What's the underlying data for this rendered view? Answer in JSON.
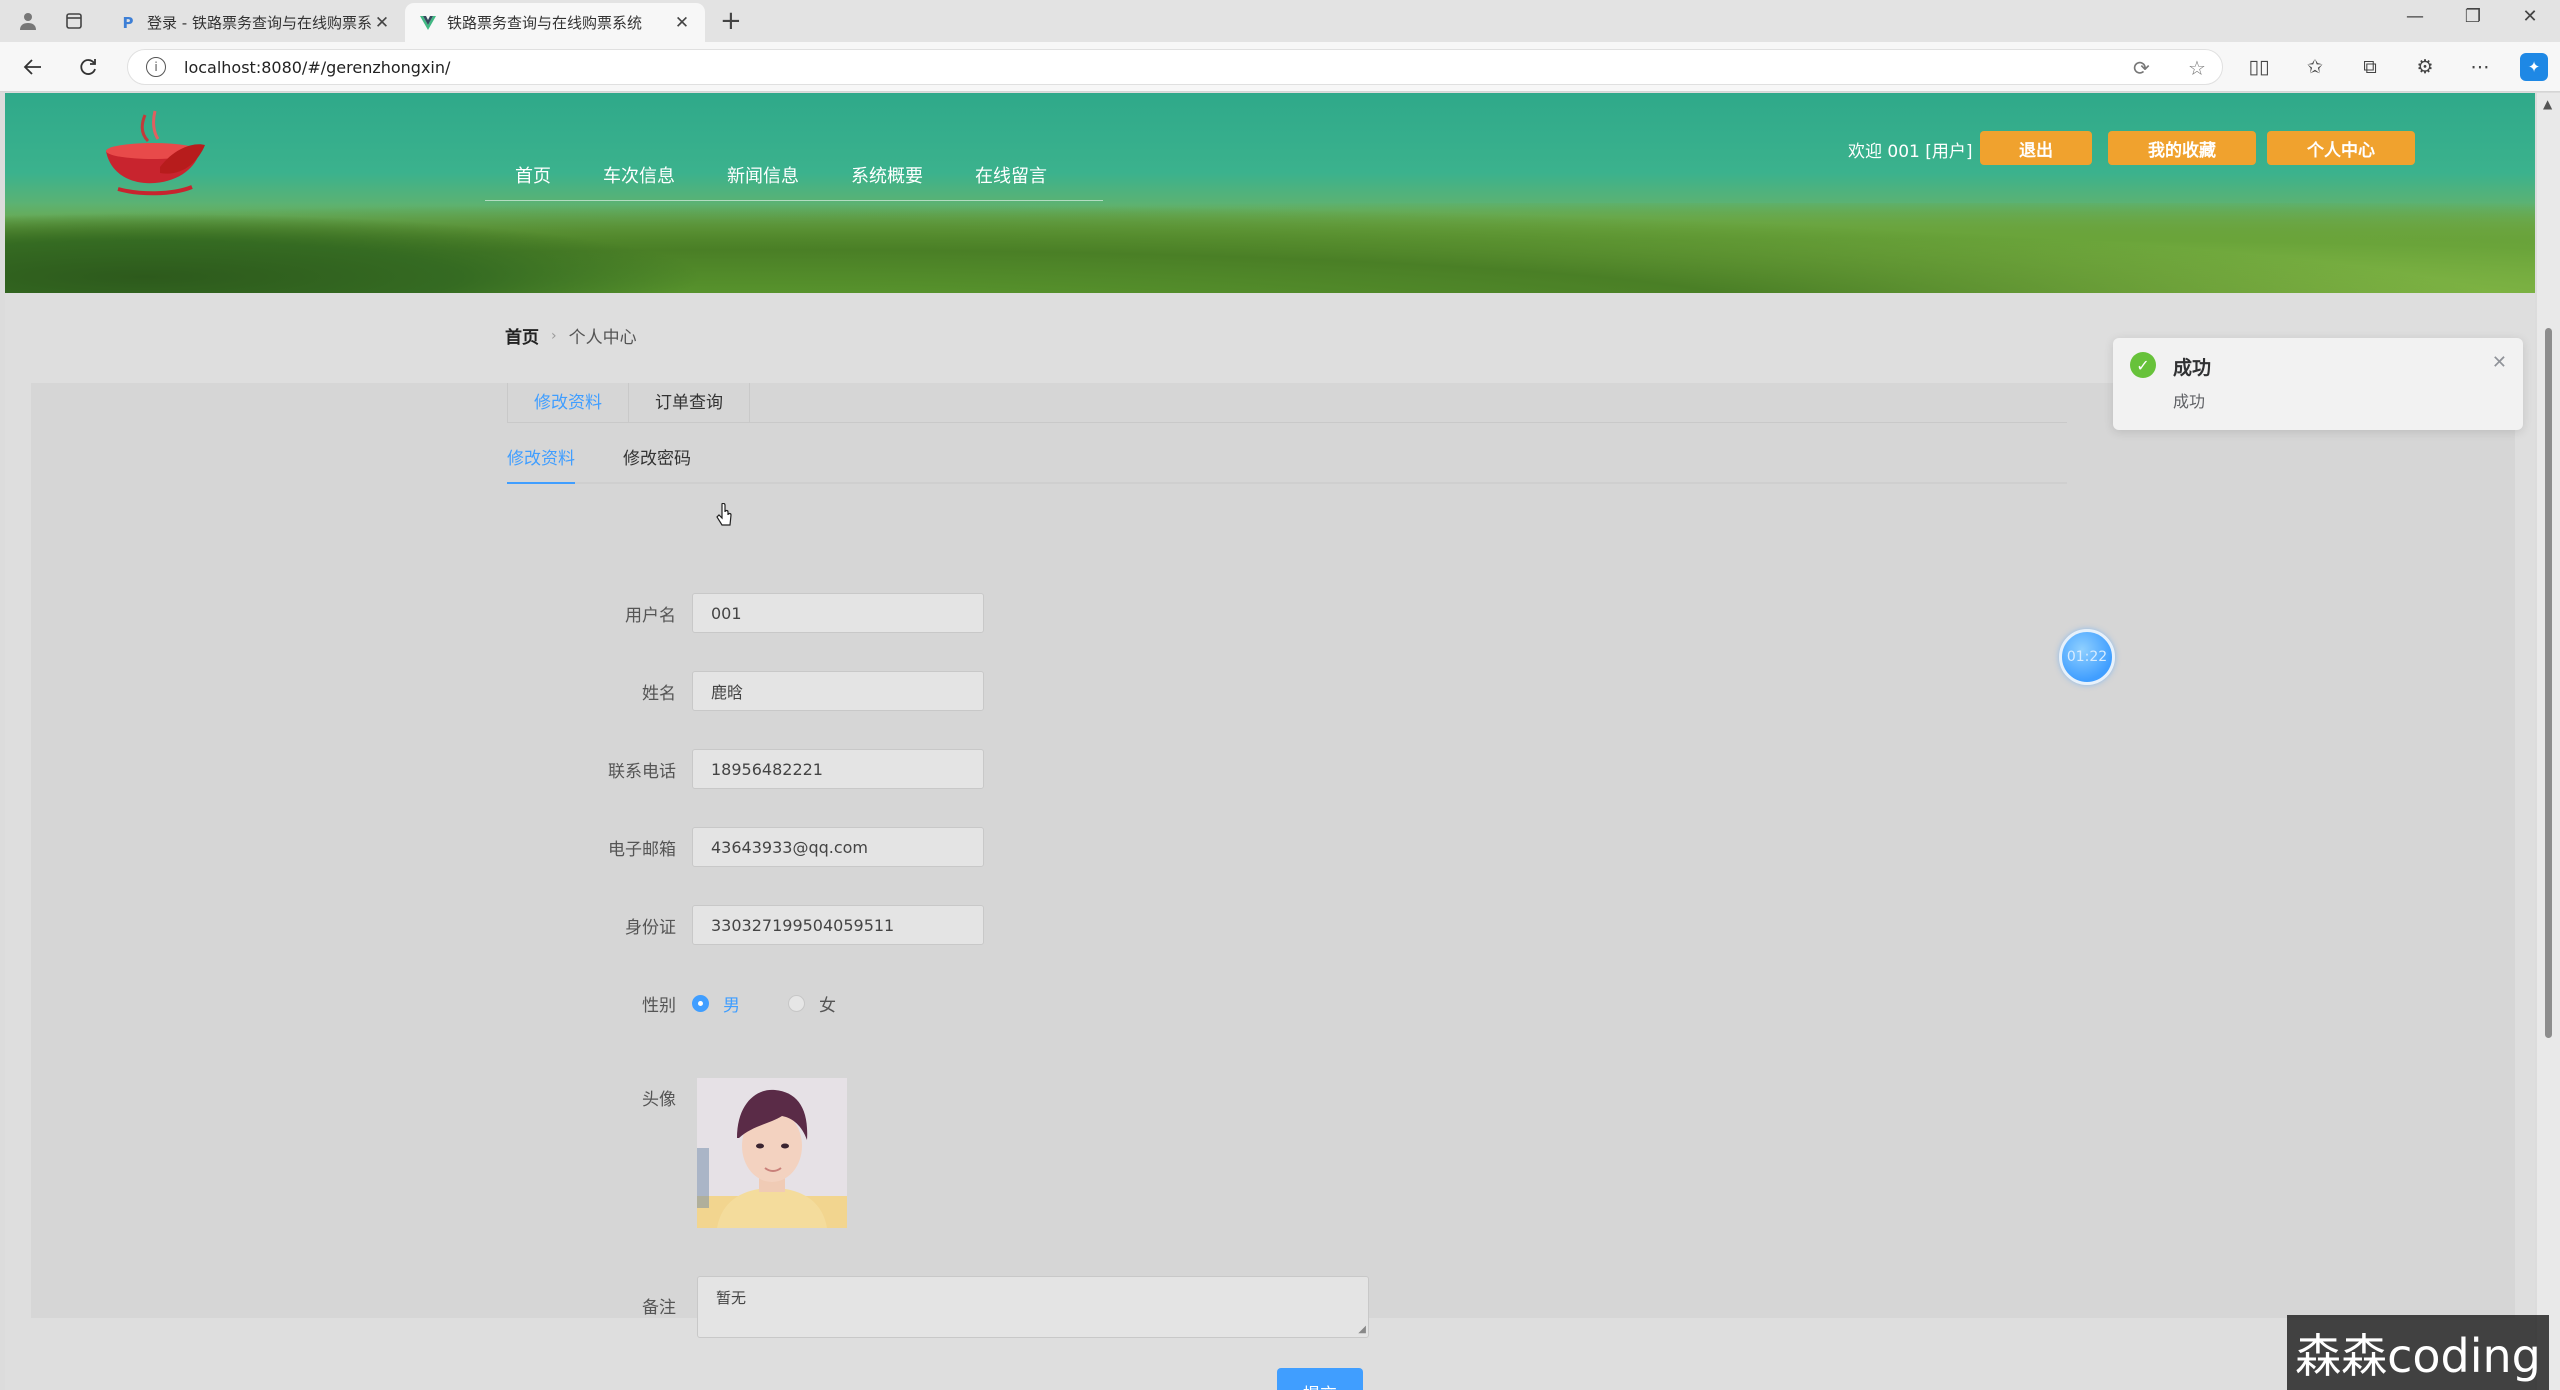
{
  "browser": {
    "tabs": [
      {
        "title": "登录 - 铁路票务查询与在线购票系",
        "active": false
      },
      {
        "title": "铁路票务查询与在线购票系统",
        "active": true
      }
    ],
    "url": "localhost:8080/#/gerenzhongxin/"
  },
  "header": {
    "nav": [
      "首页",
      "车次信息",
      "新闻信息",
      "系统概要",
      "在线留言"
    ],
    "welcome": "欢迎 001 [用户]",
    "buttons": {
      "logout": "退出",
      "favorites": "我的收藏",
      "profile": "个人中心"
    },
    "button_color": "#f0a22e"
  },
  "breadcrumb": {
    "home": "首页",
    "current": "个人中心"
  },
  "outer_tabs": [
    "修改资料",
    "订单查询"
  ],
  "inner_tabs": [
    "修改资料",
    "修改密码"
  ],
  "form": {
    "username": {
      "label": "用户名",
      "value": "001"
    },
    "name": {
      "label": "姓名",
      "value": "鹿晗"
    },
    "phone": {
      "label": "联系电话",
      "value": "18956482221"
    },
    "email": {
      "label": "电子邮箱",
      "value": "43643933@qq.com"
    },
    "idcard": {
      "label": "身份证",
      "value": "330327199504059511"
    },
    "gender": {
      "label": "性别",
      "options": [
        "男",
        "女"
      ],
      "selected": "男"
    },
    "avatar": {
      "label": "头像"
    },
    "note": {
      "label": "备注",
      "value": "暂无"
    },
    "submit": "提交"
  },
  "toast": {
    "title": "成功",
    "message": "成功"
  },
  "timer": "01:22",
  "watermark": "森森coding",
  "accent_color": "#409eff"
}
